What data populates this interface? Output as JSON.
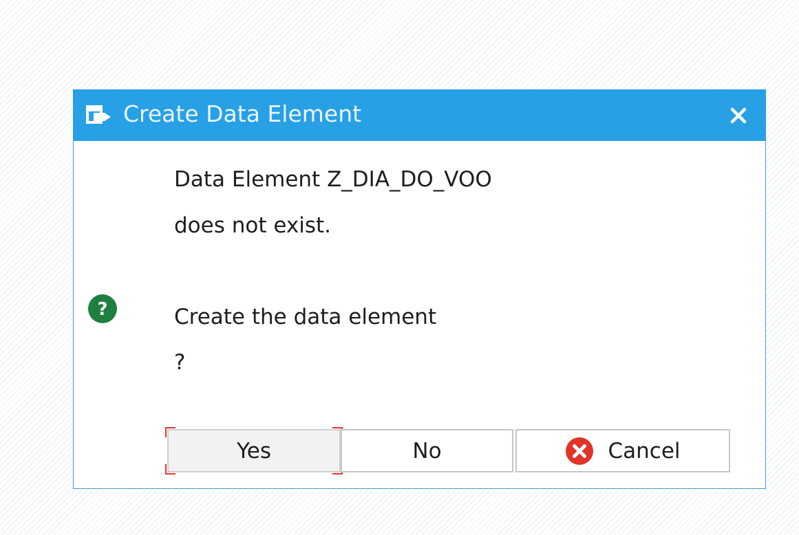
{
  "dialog": {
    "title": "Create Data Element",
    "title_icon": "dialog-window-icon",
    "close_icon": "close-icon",
    "message_line1": "Data Element Z_DIA_DO_VOO",
    "message_line2": "does not exist.",
    "question_icon": "question-icon",
    "question_line1": "Create the data element",
    "question_line2": "?",
    "buttons": {
      "yes_label": "Yes",
      "no_label": "No",
      "cancel_label": "Cancel",
      "cancel_icon": "cancel-icon"
    },
    "colors": {
      "title_bar": "#27a0e6",
      "question_icon": "#1f7f3e",
      "cancel_icon": "#e0332a",
      "focus_marker": "#e23b2e"
    }
  }
}
